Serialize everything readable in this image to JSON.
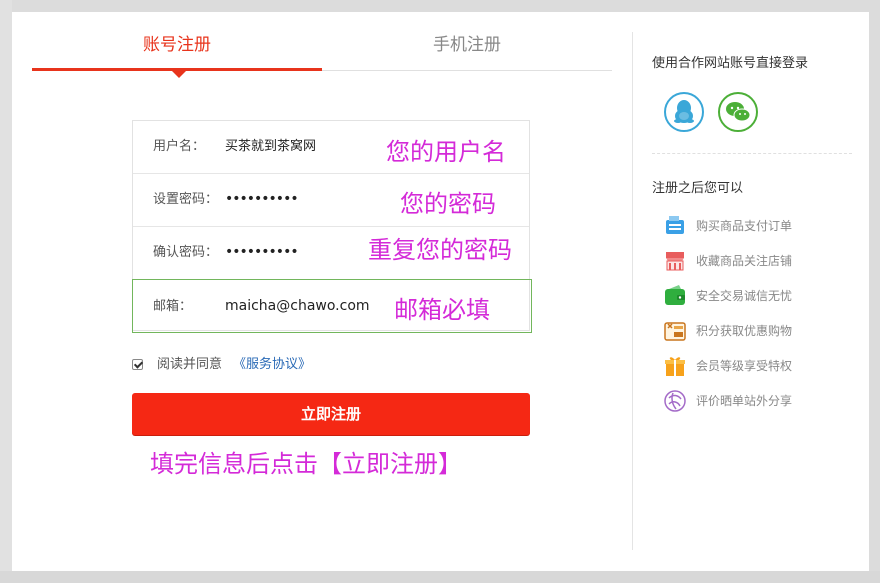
{
  "tabs": {
    "account": "账号注册",
    "phone": "手机注册"
  },
  "form": {
    "username_label": "用户名：",
    "username_value": "买茶就到茶窝网",
    "username_annot": "您的用户名",
    "password_label": "设置密码：",
    "password_value": "••••••••••",
    "password_annot": "您的密码",
    "confirm_label": "确认密码：",
    "confirm_value": "••••••••••",
    "confirm_annot": "重复您的密码",
    "email_label": "邮箱：",
    "email_value": "maicha@chawo.com",
    "email_annot": "邮箱必填"
  },
  "agree": {
    "checked": true,
    "text": "阅读并同意",
    "link": "《服务协议》"
  },
  "submit_label": "立即注册",
  "bottom_annot": "填完信息后点击【立即注册】",
  "sidebar": {
    "title": "使用合作网站账号直接登录",
    "subtitle": "注册之后您可以",
    "social": [
      "qq-icon",
      "wechat-icon"
    ],
    "benefits": [
      {
        "icon": "cashier-icon",
        "label": "购买商品支付订单"
      },
      {
        "icon": "shop-icon",
        "label": "收藏商品关注店铺"
      },
      {
        "icon": "wallet-icon",
        "label": "安全交易诚信无忧"
      },
      {
        "icon": "gift-card-icon",
        "label": "积分获取优惠购物"
      },
      {
        "icon": "gift-box-icon",
        "label": "会员等级享受特权"
      },
      {
        "icon": "share-icon",
        "label": "评价晒单站外分享"
      }
    ]
  },
  "colors": {
    "accent": "#e8341c",
    "button": "#f52814",
    "annotation": "#d42ad8",
    "link": "#2a6ab6",
    "email_border": "#72b65c"
  }
}
